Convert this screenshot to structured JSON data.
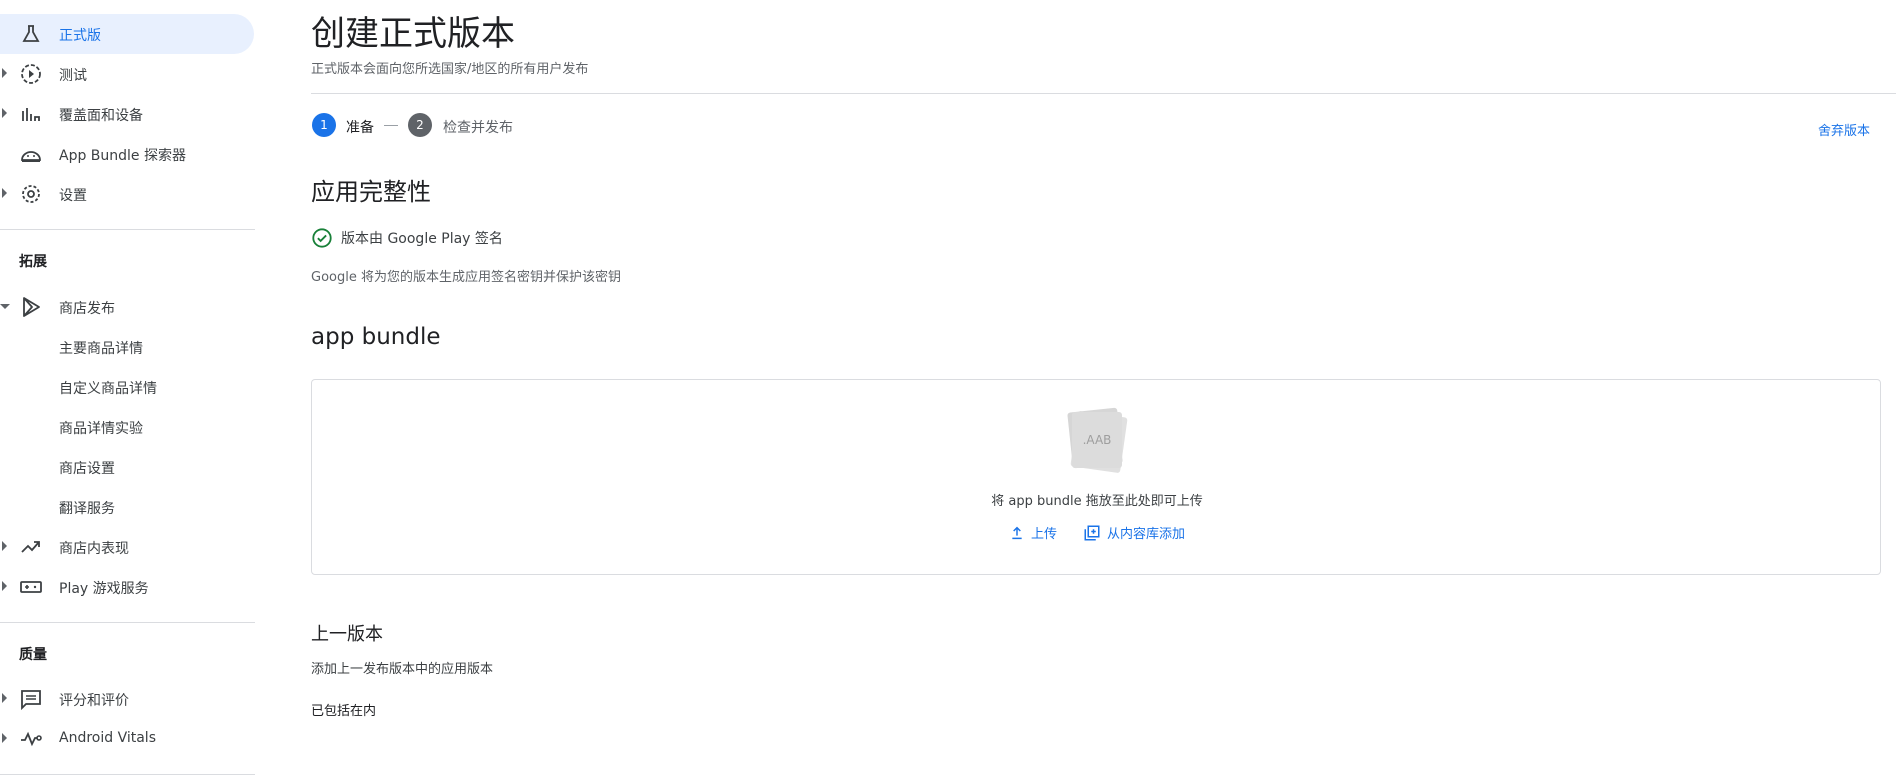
{
  "sidebar": {
    "items_top": [
      {
        "label": "正式版",
        "icon": "flask-icon",
        "active": true
      },
      {
        "label": "测试",
        "icon": "play-circle-icon"
      },
      {
        "label": "覆盖面和设备",
        "icon": "bar-chart-icon"
      },
      {
        "label": "App Bundle 探索器",
        "icon": "android-icon"
      },
      {
        "label": "设置",
        "icon": "gear-icon"
      }
    ],
    "section_grow": "拓展",
    "store": {
      "label": "商店发布",
      "icon": "play-store-icon"
    },
    "store_sub": [
      "主要商品详情",
      "自定义商品详情",
      "商品详情实验",
      "商店设置",
      "翻译服务"
    ],
    "items_mid": [
      {
        "label": "商店内表现",
        "icon": "trending-up-icon"
      },
      {
        "label": "Play 游戏服务",
        "icon": "gamepad-icon"
      }
    ],
    "section_quality": "质量",
    "items_quality": [
      {
        "label": "评分和评价",
        "icon": "review-icon"
      },
      {
        "label": "Android Vitals",
        "icon": "vitals-icon"
      }
    ]
  },
  "main": {
    "title": "创建正式版本",
    "subtitle": "正式版本会面向您所选国家/地区的所有用户发布",
    "steps": [
      {
        "number": "1",
        "label": "准备"
      },
      {
        "number": "2",
        "label": "检查并发布"
      }
    ],
    "discard": "舍弃版本",
    "integrity": {
      "title": "应用完整性",
      "signed": "版本由 Google Play 签名",
      "desc": "Google 将为您的版本生成应用签名密钥并保护该密钥"
    },
    "bundle": {
      "title": "app bundle",
      "icon_text": ".AAB",
      "hint": "将 app bundle 拖放至此处即可上传",
      "upload": "上传",
      "library": "从内容库添加"
    },
    "previous": {
      "title": "上一版本",
      "desc": "添加上一发布版本中的应用版本",
      "included": "已包括在内"
    }
  },
  "colors": {
    "accent": "#1a73e8",
    "active_bg": "#e8f0fe",
    "success": "#188038"
  }
}
